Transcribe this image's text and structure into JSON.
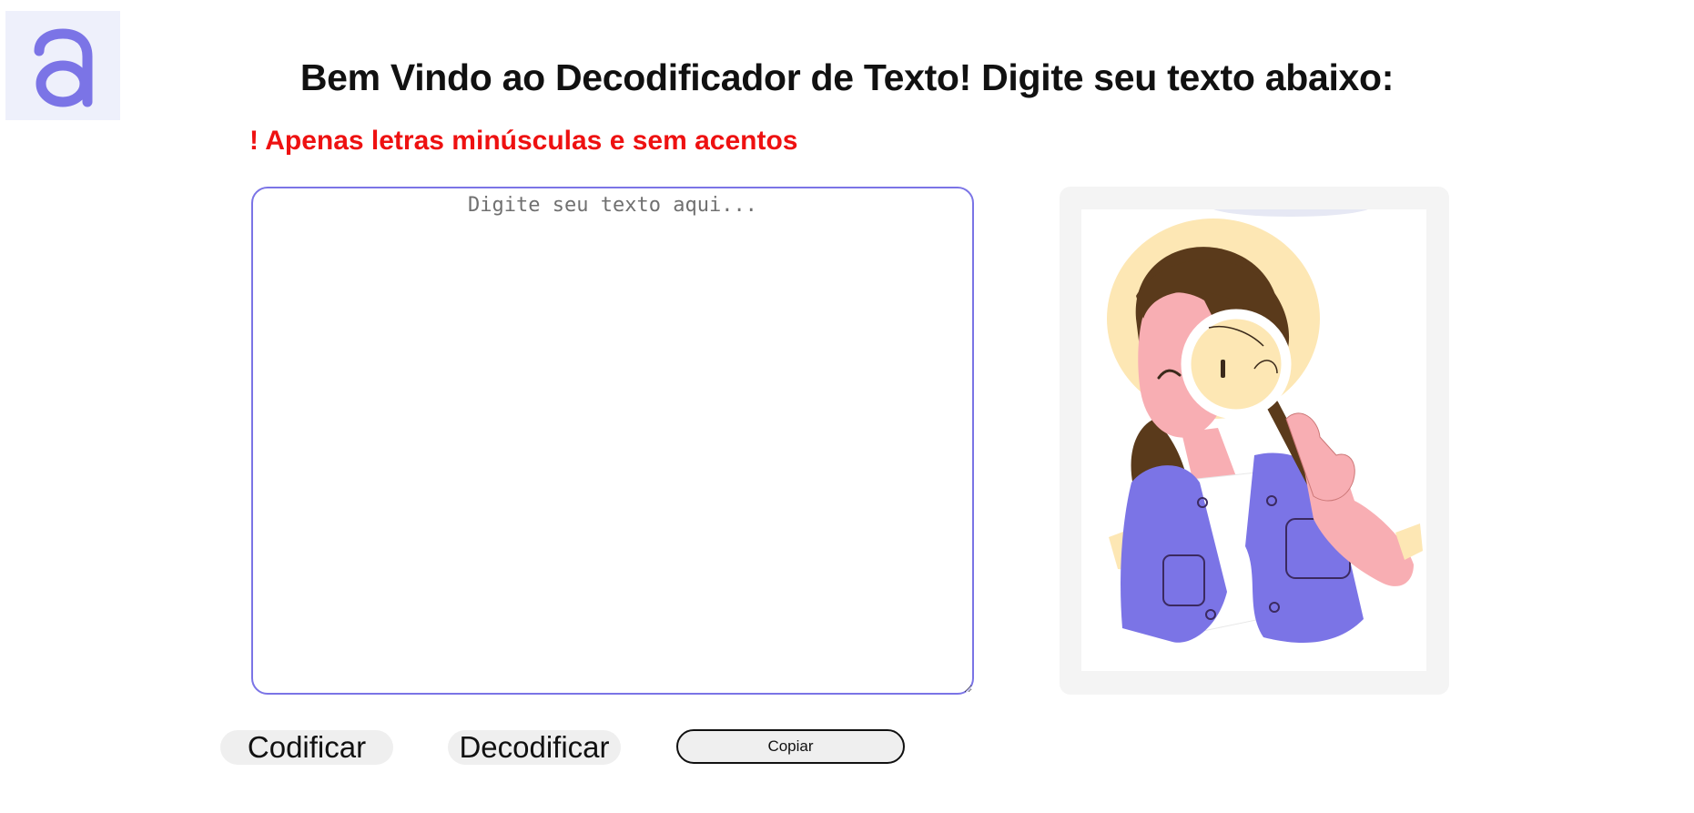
{
  "logo": {
    "letter": "a",
    "icon": "alura-logo-icon",
    "color": "#7b74e6",
    "background": "#eef0fb"
  },
  "header": {
    "title": "Bem Vindo ao Decodificador de Texto! Digite seu texto abaixo:"
  },
  "notice": {
    "text": "! Apenas letras minúsculas e sem acentos",
    "color": "#ee1111"
  },
  "editor": {
    "placeholder": "Digite seu texto aqui...",
    "value": ""
  },
  "illustration": {
    "icon": "girl-with-magnifier-illustration"
  },
  "actions": {
    "encode_label": "Codificar",
    "decode_label": "Decodificar",
    "copy_label": "Copiar"
  },
  "colors": {
    "accent": "#7b74e6",
    "panel_bg": "#f4f4f4",
    "button_bg": "#efefef"
  }
}
